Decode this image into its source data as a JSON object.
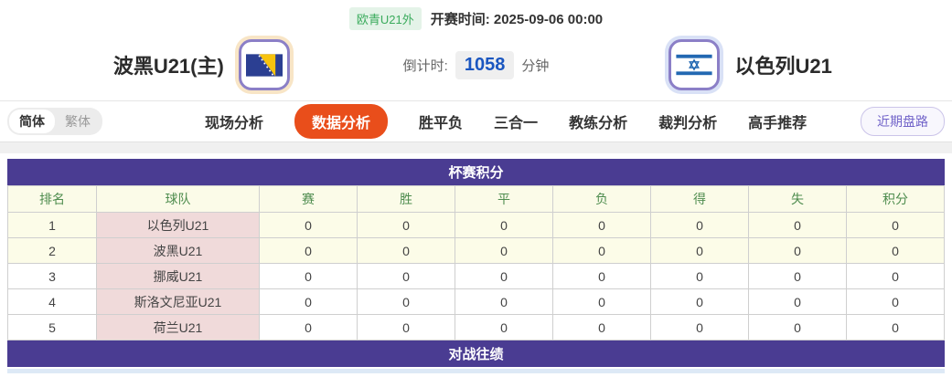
{
  "header": {
    "league_badge": "欧青U21外",
    "kickoff_label": "开赛时间:",
    "kickoff_time": "2025-09-06 00:00",
    "home_team": "波黑U21(主)",
    "away_team": "以色列U21",
    "countdown_label": "倒计时:",
    "countdown_value": "1058",
    "countdown_unit": "分钟",
    "home_flag": "bosnia-flag",
    "away_flag": "israel-flag"
  },
  "nav": {
    "lang_simplified": "简体",
    "lang_traditional": "繁体",
    "tabs": [
      {
        "label": "现场分析",
        "active": false
      },
      {
        "label": "数据分析",
        "active": true
      },
      {
        "label": "胜平负",
        "active": false
      },
      {
        "label": "三合一",
        "active": false
      },
      {
        "label": "教练分析",
        "active": false
      },
      {
        "label": "裁判分析",
        "active": false
      },
      {
        "label": "高手推荐",
        "active": false
      }
    ],
    "recent_button": "近期盘路"
  },
  "standings": {
    "title": "杯赛积分",
    "columns": [
      "排名",
      "球队",
      "赛",
      "胜",
      "平",
      "负",
      "得",
      "失",
      "积分"
    ],
    "rows": [
      {
        "rank": "1",
        "team": "以色列U21",
        "values": [
          "0",
          "0",
          "0",
          "0",
          "0",
          "0",
          "0"
        ],
        "highlight": true
      },
      {
        "rank": "2",
        "team": "波黑U21",
        "values": [
          "0",
          "0",
          "0",
          "0",
          "0",
          "0",
          "0"
        ],
        "highlight": true
      },
      {
        "rank": "3",
        "team": "挪威U21",
        "values": [
          "0",
          "0",
          "0",
          "0",
          "0",
          "0",
          "0"
        ],
        "highlight": false
      },
      {
        "rank": "4",
        "team": "斯洛文尼亚U21",
        "values": [
          "0",
          "0",
          "0",
          "0",
          "0",
          "0",
          "0"
        ],
        "highlight": false
      },
      {
        "rank": "5",
        "team": "荷兰U21",
        "values": [
          "0",
          "0",
          "0",
          "0",
          "0",
          "0",
          "0"
        ],
        "highlight": false
      }
    ]
  },
  "next_section": {
    "title": "对战往绩"
  },
  "colors": {
    "section_header": "#4a3c92",
    "active_tab": "#e94e1b",
    "badge_green": "#3aab5c",
    "countdown_blue": "#1a56c0",
    "table_header_bg": "#fbfbe8",
    "team_cell_pink": "#f0dada",
    "highlight_row": "#fcfce8"
  }
}
